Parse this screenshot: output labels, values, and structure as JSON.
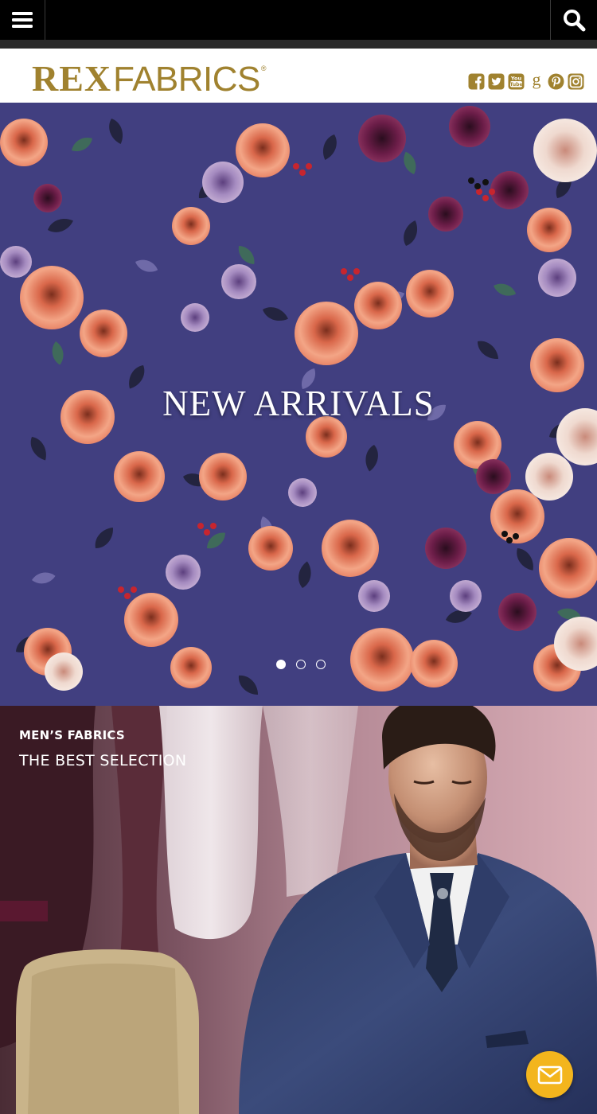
{
  "topbar": {
    "menu_icon": "hamburger-menu-icon",
    "search_icon": "search-icon"
  },
  "header": {
    "logo": {
      "part1": "REX",
      "part2": "FABRICS",
      "registered": "®",
      "color": "#a0822f"
    },
    "socials": [
      {
        "name": "facebook-icon"
      },
      {
        "name": "twitter-icon"
      },
      {
        "name": "youtube-icon"
      },
      {
        "name": "google-icon"
      },
      {
        "name": "pinterest-icon"
      },
      {
        "name": "instagram-icon"
      }
    ],
    "social_color": "#a0822f"
  },
  "hero": {
    "title": "NEW ARRIVALS",
    "background_color": "#3f3d7f",
    "slides": 3,
    "active_slide": 1
  },
  "mens_section": {
    "kicker": "MEN’S FABRICS",
    "title": "THE BEST SELECTION"
  },
  "contact_button": {
    "icon": "mail-icon",
    "color": "#f3b51d"
  }
}
